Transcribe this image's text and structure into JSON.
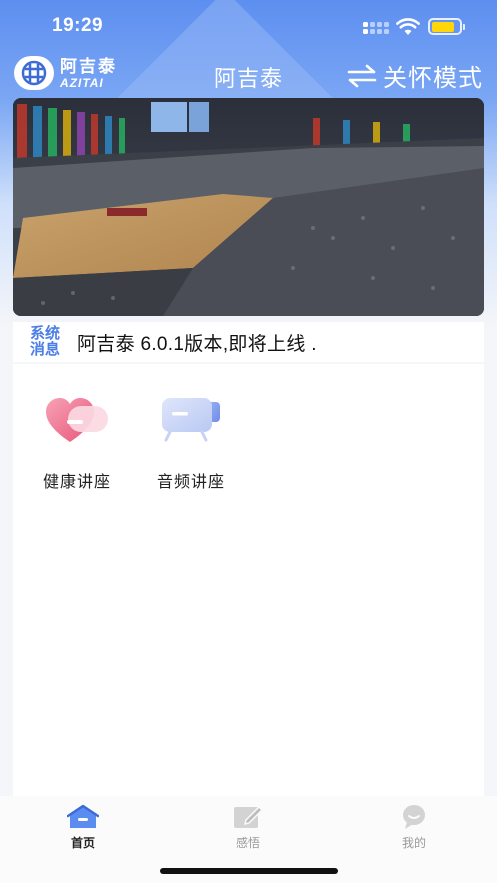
{
  "status_bar": {
    "time": "19:29",
    "battery_level": 0.85,
    "battery_color": "#ffd60a"
  },
  "nav": {
    "logo": {
      "text_cn": "阿吉泰",
      "text_en": "AZITAI"
    },
    "title": "阿吉泰",
    "care_mode_label": "关怀模式",
    "care_mode_icon": "swap-arrows-icon"
  },
  "banner": {
    "icon": "auditorium-lecture-photo"
  },
  "notice": {
    "tag_line1": "系统",
    "tag_line2": "消息",
    "text": "阿吉泰 6.0.1版本,即将上线 ."
  },
  "features": [
    {
      "label": "健康讲座",
      "icon": "heart-health-icon"
    },
    {
      "label": "音频讲座",
      "icon": "video-camera-icon"
    }
  ],
  "tabbar": {
    "tabs": [
      {
        "label": "首页",
        "icon": "home-icon",
        "active": true
      },
      {
        "label": "感悟",
        "icon": "edit-note-icon",
        "active": false
      },
      {
        "label": "我的",
        "icon": "profile-chat-icon",
        "active": false
      }
    ]
  },
  "colors": {
    "brand_blue": "#5d8ff0",
    "notice_tag": "#4b7ee8",
    "heart_pink": "#f07c9a"
  }
}
